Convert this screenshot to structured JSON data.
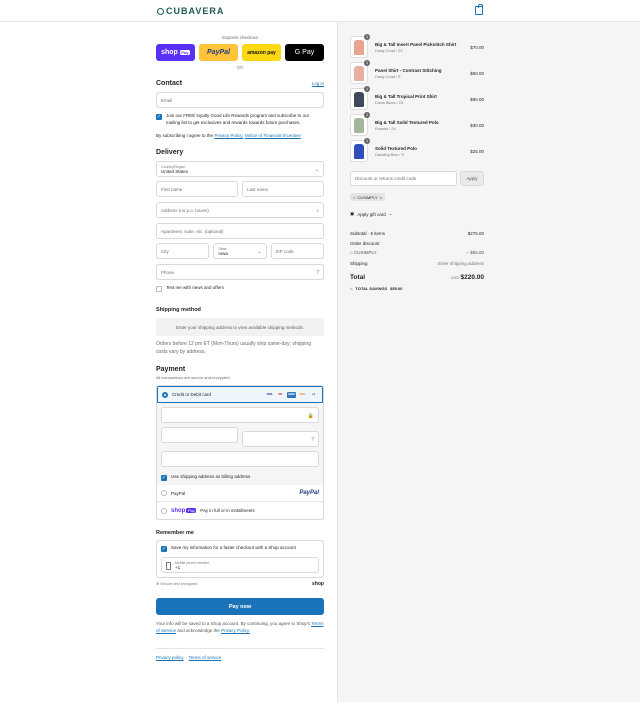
{
  "brand": {
    "name": "CUBAVERA"
  },
  "express": {
    "label": "Express checkout",
    "shop": "shop",
    "shop_badge": "Pay",
    "paypal": "PayPal",
    "amazon": "amazon pay",
    "gpay": "G Pay",
    "or": "OR"
  },
  "contact": {
    "title": "Contact",
    "login": "Log in",
    "email_placeholder": "Email",
    "optin": "Join our FREE loyalty Good Life Rewards program and subscribe to our mailing list to get exclusives and rewards towards future purchases.",
    "agree_prefix": "By subscribing I agree to the",
    "privacy": "Privacy Policy,",
    "financial": "Notice of Financial Incentive"
  },
  "delivery": {
    "title": "Delivery",
    "country_label": "Country/Region",
    "country": "United States",
    "first": "First name",
    "last": "Last name",
    "address": "Address (no p.o. boxes)",
    "apt": "Apartment, suite, etc. (optional)",
    "city": "City",
    "state_label": "State",
    "state": "Iowa",
    "zip": "ZIP code",
    "phone": "Phone",
    "sms": "Text me with news and offers"
  },
  "shipping": {
    "title": "Shipping method",
    "placeholder": "Enter your shipping address to view available shipping methods.",
    "note": "Orders before 12 pm ET (Mon-Thurs) usually ship same-day; shipping costs vary by address."
  },
  "payment": {
    "title": "Payment",
    "subtitle": "All transactions are secure and encrypted.",
    "card_label": "Credit or Debit card",
    "billing": "Use shipping address as billing address",
    "paypal": "PayPal",
    "paypal_logo": "PayPal",
    "shop_pay": "shop",
    "shop_badge": "Pay",
    "shop_text": "Pay in full or in installments",
    "card_brands": [
      "VISA",
      "MC",
      "AMEX",
      "DISC",
      "+4"
    ]
  },
  "remember": {
    "title": "Remember me",
    "save": "Save my information for a faster checkout with a Shop account",
    "mobile_label": "Mobile phone number",
    "mobile_prefix": "+1",
    "secure": "Secure and encrypted",
    "shop": "shop"
  },
  "pay_now": "Pay now",
  "legal": {
    "text": "Your info will be saved to a Shop account. By continuing, you agree to Shop's",
    "tos": "Terms of Service",
    "and": "and acknowledge the",
    "privacy": "Privacy Policy."
  },
  "footer": {
    "privacy": "Privacy policy",
    "terms": "Terms of service"
  },
  "cart": {
    "items": [
      {
        "name": "Big & Tall Insert Panel Pickstitch Shirt",
        "variant": "Dusty Coral / 2X",
        "price": "$70.00",
        "qty": "1",
        "color": "#e9a38f"
      },
      {
        "name": "Panel Shirt - Contrast Stitching",
        "variant": "Dusty Coral / S",
        "price": "$60.00",
        "qty": "1",
        "color": "#e8b0a0"
      },
      {
        "name": "Big & Tall Tropical Print Shirt",
        "variant": "Dress Blues / 2X",
        "price": "$90.00",
        "qty": "1",
        "color": "#3e4a5c"
      },
      {
        "name": "Big & Tall Solid Textured Polo",
        "variant": "Rosado / 2X",
        "price": "$30.00",
        "qty": "1",
        "color": "#a3b89b"
      },
      {
        "name": "Solid Textured Polo",
        "variant": "Dazzling Blue / S",
        "price": "$25.00",
        "qty": "1",
        "color": "#2f4fb8"
      }
    ],
    "discount_placeholder": "Discount or returns credit code",
    "apply": "Apply",
    "code": "CUSIMPLY",
    "gift": "Apply gift card",
    "subtotal_label": "Subtotal · 5 items",
    "subtotal": "$275.00",
    "order_discount": "Order discount",
    "discount_code": "CUSIMPLY",
    "discount_amount": "– $55.00",
    "shipping_label": "Shipping",
    "shipping_value": "Enter shipping address",
    "total_label": "Total",
    "currency": "USD",
    "total": "$220.00",
    "savings_label": "TOTAL SAVINGS",
    "savings": "$55.00"
  }
}
